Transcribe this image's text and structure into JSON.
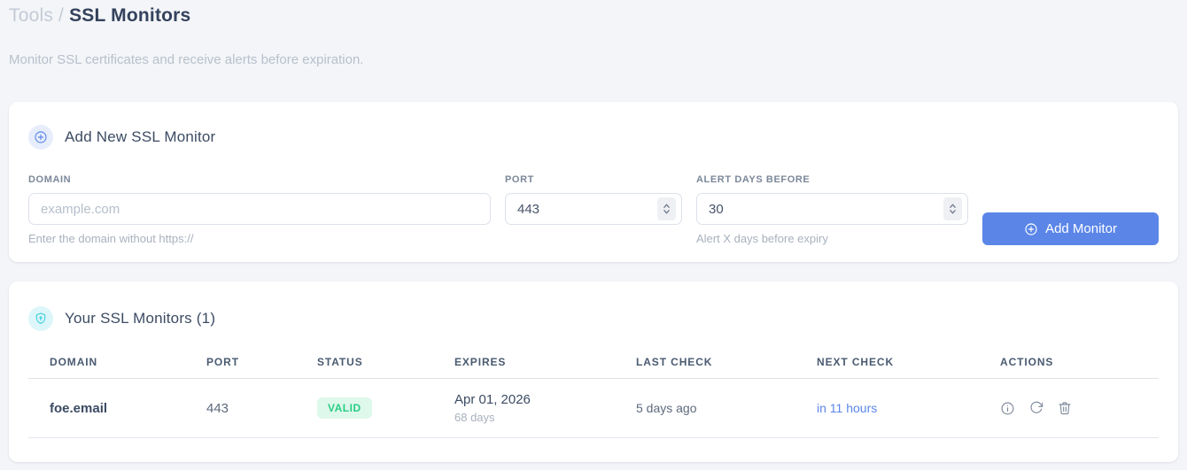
{
  "page": {
    "breadcrumb": {
      "parent": "Tools",
      "separator": "/",
      "current": "SSL Monitors"
    },
    "subtitle": "Monitor SSL certificates and receive alerts before expiration."
  },
  "add_monitor": {
    "title": "Add New SSL Monitor",
    "header_icon": "plus-circle-icon",
    "fields": {
      "domain": {
        "label": "DOMAIN",
        "placeholder": "example.com",
        "value": "",
        "helper": "Enter the domain without https://"
      },
      "port": {
        "label": "PORT",
        "value": "443"
      },
      "alert_days": {
        "label": "ALERT DAYS BEFORE",
        "value": "30",
        "helper": "Alert X days before expiry"
      }
    },
    "submit_label": "Add Monitor"
  },
  "monitors": {
    "title": "Your SSL Monitors (1)",
    "header_icon": "shield-icon",
    "table": {
      "headers": [
        "DOMAIN",
        "PORT",
        "STATUS",
        "EXPIRES",
        "LAST CHECK",
        "NEXT CHECK",
        "ACTIONS"
      ],
      "rows": [
        {
          "domain": "foe.email",
          "port": "443",
          "status": "VALID",
          "expires_date": "Apr 01, 2026",
          "expires_days": "68 days",
          "last_check": "5 days ago",
          "next_check": "in 11 hours",
          "actions": [
            "info-icon",
            "refresh-icon",
            "trash-icon"
          ]
        }
      ]
    }
  },
  "colors": {
    "accent_blue": "#5b86e8",
    "accent_cyan": "#3ccfdd",
    "status_valid_bg": "#def8eb",
    "status_valid_text": "#29cd85",
    "page_background": "#f4f5f8"
  }
}
